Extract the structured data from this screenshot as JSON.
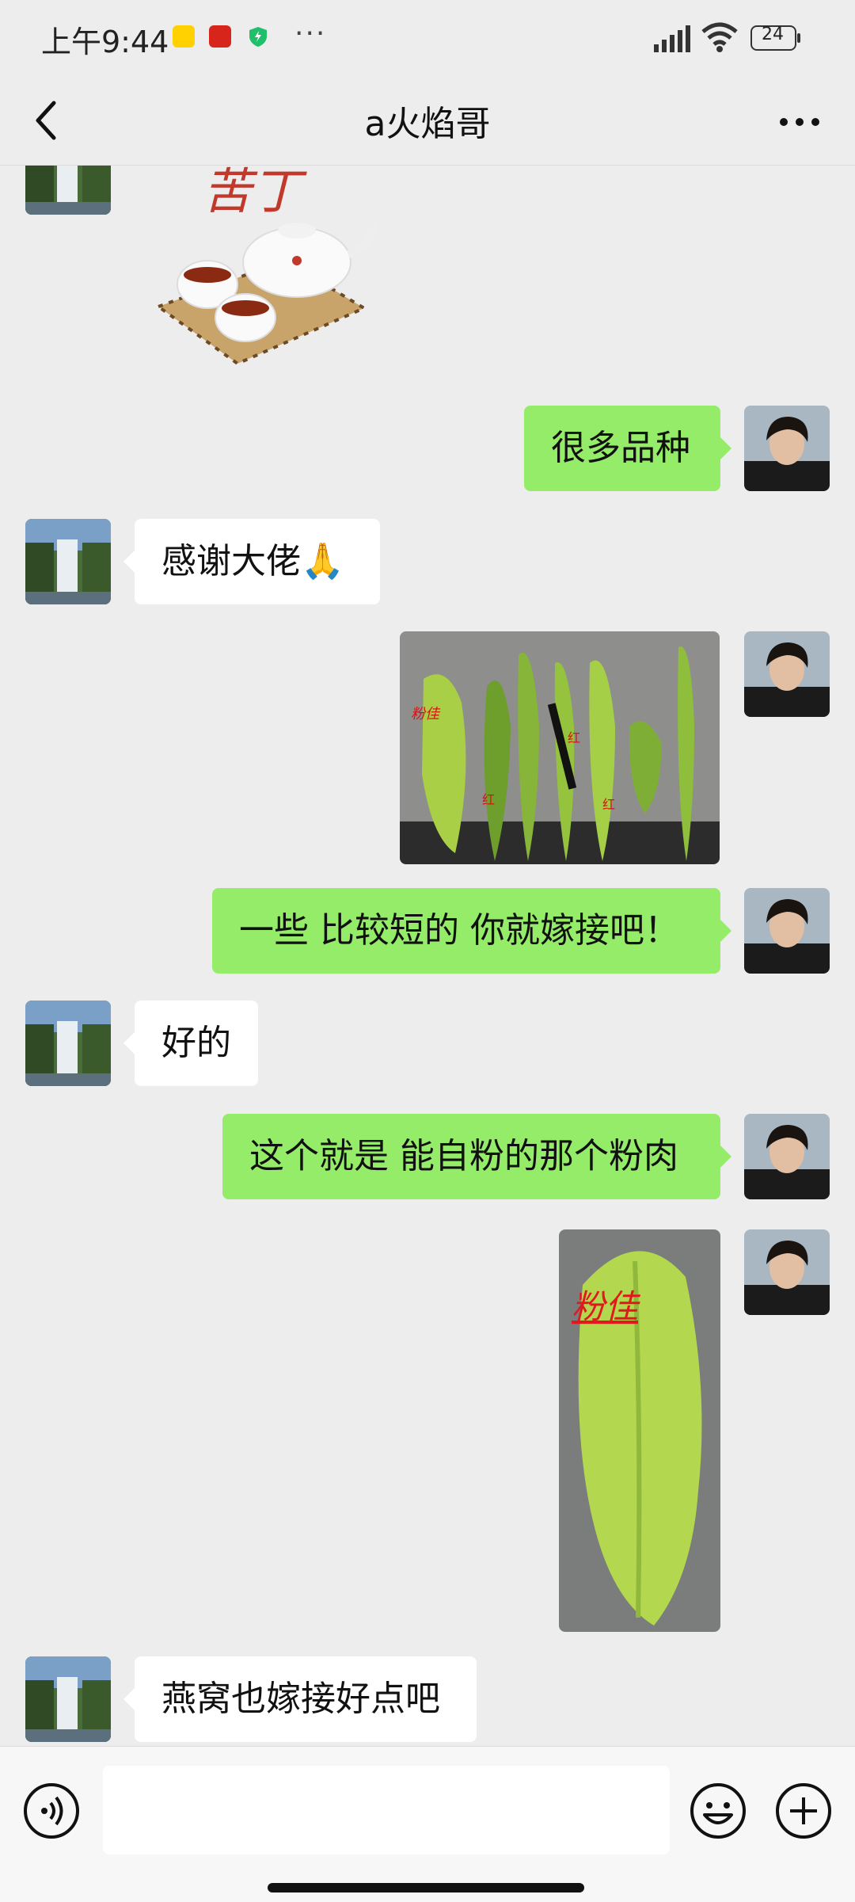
{
  "status_bar": {
    "time": "上午9:44",
    "notification_icons": [
      "meituan-app-icon",
      "mcdonalds-app-icon",
      "security-shield-icon"
    ],
    "more_dots": "···",
    "battery_level": "24"
  },
  "header": {
    "title": "a火焰哥",
    "back_icon": "chevron-left-icon",
    "more_icon": "more-horizontal-icon"
  },
  "messages": [
    {
      "from": "contact",
      "type": "sticker",
      "description_icon": "tea-sticker"
    },
    {
      "from": "me",
      "type": "text",
      "text": "很多品种"
    },
    {
      "from": "contact",
      "type": "text",
      "text": "感谢大佬🙏"
    },
    {
      "from": "me",
      "type": "image",
      "image_labels": [
        "粉佳",
        "红",
        "红",
        "红"
      ]
    },
    {
      "from": "me",
      "type": "text",
      "text": "一些 比较短的 你就嫁接吧！"
    },
    {
      "from": "contact",
      "type": "text",
      "text": "好的"
    },
    {
      "from": "me",
      "type": "text",
      "text": "这个就是 能自粉的那个粉肉"
    },
    {
      "from": "me",
      "type": "image",
      "image_labels": [
        "粉佳"
      ]
    },
    {
      "from": "contact",
      "type": "text",
      "text": "燕窝也嫁接好点吧"
    }
  ],
  "sticker": {
    "text": "苦丁"
  },
  "input_bar": {
    "voice_icon": "voice-icon",
    "input_value": "",
    "emoji_icon": "emoji-icon",
    "plus_icon": "plus-icon"
  },
  "colors": {
    "background": "#ededed",
    "outgoing_bubble": "#95ec69",
    "incoming_bubble": "#ffffff"
  }
}
